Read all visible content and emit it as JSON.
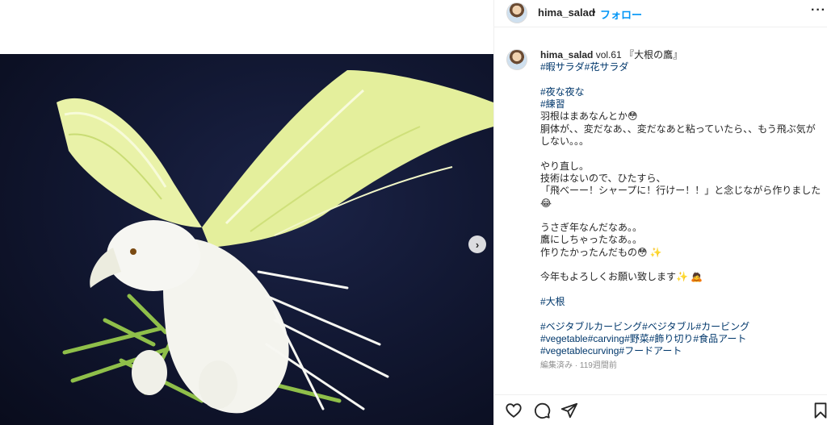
{
  "post": {
    "username": "hima_salad",
    "header_dot": "•",
    "follow_label": "フォロー",
    "more_label": "···"
  },
  "caption": {
    "username": "hima_salad",
    "lines": [
      {
        "kind": "text",
        "text": " vol.61 『大根の鷹』"
      },
      {
        "kind": "tag",
        "text": "#暇サラダ#花サラダ"
      },
      {
        "kind": "gap"
      },
      {
        "kind": "tag",
        "text": "#夜な夜な"
      },
      {
        "kind": "tag",
        "text": "#練習"
      },
      {
        "kind": "text",
        "text": "羽根はまあなんとか😳"
      },
      {
        "kind": "text",
        "text": "胴体が、、変だなあ、、変だなあと粘っていたら、、もう飛ぶ気がしない。。。"
      },
      {
        "kind": "gap"
      },
      {
        "kind": "text",
        "text": "やり直し。"
      },
      {
        "kind": "text",
        "text": "技術はないので、ひたすら、"
      },
      {
        "kind": "text",
        "text": "「飛べーー！シャープに！行けー！！」と念じながら作りました😂"
      },
      {
        "kind": "gap"
      },
      {
        "kind": "text",
        "text": "うさぎ年なんだなあ。。"
      },
      {
        "kind": "text",
        "text": "鷹にしちゃったなあ。。"
      },
      {
        "kind": "text",
        "text": "作りたかったんだもの😳 ✨"
      },
      {
        "kind": "gap"
      },
      {
        "kind": "text",
        "text": "今年もよろしくお願い致します✨ 🙇"
      },
      {
        "kind": "gap"
      },
      {
        "kind": "tag",
        "text": "#大根"
      },
      {
        "kind": "gap"
      },
      {
        "kind": "tag",
        "text": "#ベジタブルカービング#ベジタブル#カービング"
      },
      {
        "kind": "tag",
        "text": "#vegetable#carving#野菜#飾り切り#食品アート"
      },
      {
        "kind": "tag",
        "text": "#vegetablecurving#フードアート"
      }
    ],
    "edited": "編集済み · 119週間前"
  },
  "media": {
    "next_label": "›"
  },
  "actions": {
    "icons": [
      "heart-icon",
      "comment-icon",
      "share-icon",
      "bookmark-icon"
    ]
  },
  "colors": {
    "link": "#0095f6",
    "hashtag": "#00376b",
    "text": "#262626",
    "muted": "#8e8e8e",
    "photo_bg": "#121833"
  }
}
